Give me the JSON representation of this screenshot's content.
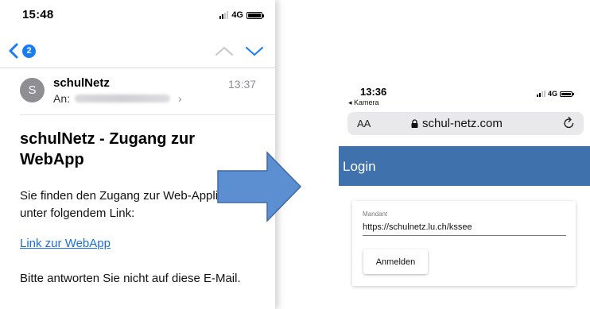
{
  "mail_phone": {
    "status_time": "15:48",
    "network": "4G",
    "unread_badge": "2",
    "sender_initial": "S",
    "sender": "schulNetz",
    "received_time": "13:37",
    "to_label": "An:",
    "subject": "schulNetz - Zugang zur WebApp",
    "body": "Sie finden den Zugang zur Web-Applikation unter folgendem Link:",
    "link_text": "Link zur WebApp",
    "closing": "Bitte antworten Sie nicht auf diese E-Mail.",
    "colors": {
      "accent": "#1a7cf5",
      "link": "#1a6fd9"
    }
  },
  "arrow": {
    "color": "#5b8fd1",
    "direction": "right"
  },
  "browser_phone": {
    "status_time": "13:36",
    "back_app": "◂ Kamera",
    "network": "4G",
    "text_size": "AA",
    "url": "schul-netz.com",
    "page_title": "Login",
    "mandant_label": "Mandant",
    "mandant_value": "https://schulnetz.lu.ch/kssee",
    "login_button": "Anmelden",
    "colors": {
      "header": "#3f72ad"
    }
  }
}
